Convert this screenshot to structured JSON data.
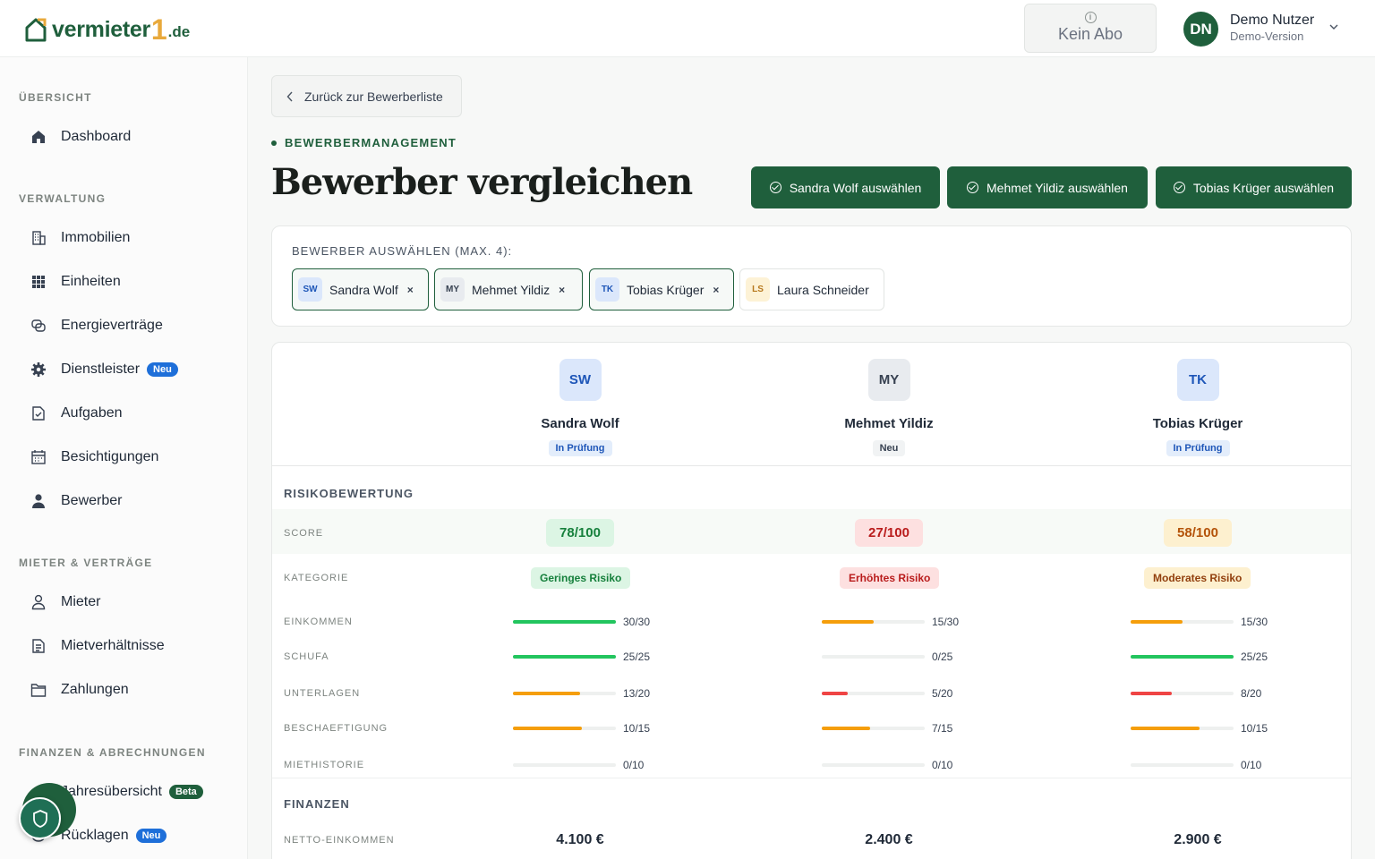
{
  "header": {
    "logo_text": "vermieter",
    "logo_one": "1",
    "logo_tld": ".de",
    "abo_label": "Kein Abo",
    "user_initials": "DN",
    "user_name": "Demo Nutzer",
    "user_sub": "Demo-Version"
  },
  "sidebar": {
    "sections": [
      "ÜBERSICHT",
      "VERWALTUNG",
      "MIETER & VERTRÄGE",
      "FINANZEN & ABRECHNUNGEN"
    ],
    "items": [
      {
        "label": "Dashboard",
        "icon": "home-icon"
      },
      {
        "label": "Immobilien",
        "icon": "building-icon"
      },
      {
        "label": "Einheiten",
        "icon": "grid-icon"
      },
      {
        "label": "Energieverträge",
        "icon": "energy-icon"
      },
      {
        "label": "Dienstleister",
        "icon": "gear-icon",
        "badge": "Neu"
      },
      {
        "label": "Aufgaben",
        "icon": "task-icon"
      },
      {
        "label": "Besichtigungen",
        "icon": "calendar-icon"
      },
      {
        "label": "Bewerber",
        "icon": "person-filled-icon"
      },
      {
        "label": "Mieter",
        "icon": "person-icon"
      },
      {
        "label": "Mietverhältnisse",
        "icon": "document-icon"
      },
      {
        "label": "Zahlungen",
        "icon": "folder-icon"
      },
      {
        "label": "Jahresübersicht",
        "icon": "chart-icon",
        "badge": "Beta"
      },
      {
        "label": "Rücklagen",
        "icon": "piggy-icon",
        "badge": "Neu"
      }
    ]
  },
  "main": {
    "back_label": "Zurück zur Bewerberliste",
    "eyebrow": "BEWERBERMANAGEMENT",
    "title": "Bewerber vergleichen",
    "select_buttons": [
      "Sandra Wolf auswählen",
      "Mehmet Yildiz auswählen",
      "Tobias Krüger auswählen"
    ],
    "picker_label": "BEWERBER AUSWÄHLEN (MAX. 4):",
    "chips": [
      {
        "initials": "SW",
        "name": "Sandra Wolf",
        "selected": true
      },
      {
        "initials": "MY",
        "name": "Mehmet Yildiz",
        "selected": true
      },
      {
        "initials": "TK",
        "name": "Tobias Krüger",
        "selected": true
      },
      {
        "initials": "LS",
        "name": "Laura Schneider",
        "selected": false
      }
    ],
    "chip_remove": "×",
    "applicants": [
      {
        "initials": "SW",
        "name": "Sandra Wolf",
        "status": "In Prüfung",
        "score": "78/100",
        "category": "Geringes Risiko",
        "netto": "4.100 €"
      },
      {
        "initials": "MY",
        "name": "Mehmet Yildiz",
        "status": "Neu",
        "score": "27/100",
        "category": "Erhöhtes Risiko",
        "netto": "2.400 €"
      },
      {
        "initials": "TK",
        "name": "Tobias Krüger",
        "status": "In Prüfung",
        "score": "58/100",
        "category": "Moderates Risiko",
        "netto": "2.900 €"
      }
    ],
    "risk_section": "RISIKOBEWERTUNG",
    "score_label": "SCORE",
    "category_label": "KATEGORIE",
    "metrics": [
      {
        "label": "EINKOMMEN",
        "values": [
          "30/30",
          "15/30",
          "15/30"
        ]
      },
      {
        "label": "SCHUFA",
        "values": [
          "25/25",
          "0/25",
          "25/25"
        ]
      },
      {
        "label": "UNTERLAGEN",
        "values": [
          "13/20",
          "5/20",
          "8/20"
        ]
      },
      {
        "label": "BESCHAEFTIGUNG",
        "values": [
          "10/15",
          "7/15",
          "10/15"
        ]
      },
      {
        "label": "MIETHISTORIE",
        "values": [
          "0/10",
          "0/10",
          "0/10"
        ]
      }
    ],
    "finance_section": "FINANZEN",
    "netto_label": "NETTO-EINKOMMEN"
  },
  "colors": {
    "brand": "#1f5f3c",
    "accent": "#e8a93b",
    "green": "#22c55e",
    "orange": "#f59e0b",
    "red": "#ef4444"
  }
}
